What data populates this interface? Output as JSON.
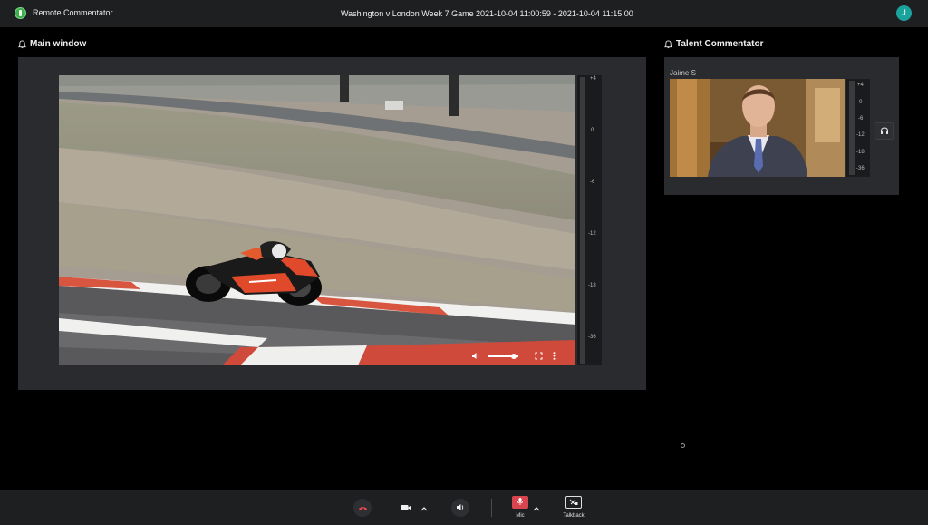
{
  "app": {
    "name": "Remote Commentator",
    "user_initial": "J"
  },
  "session": {
    "event_title": "Washington v London Week 7 Game",
    "time_range": "2021-10-04 11:00:59 - 2021-10-04 11:15:00"
  },
  "main_window": {
    "title": "Main window",
    "audio_meter_ticks": [
      "+4",
      "0",
      "-6",
      "-12",
      "-18",
      "-36"
    ],
    "player": {
      "volume_level": 0.85
    }
  },
  "talent": {
    "title": "Talent Commentator",
    "name": "Jaime S",
    "audio_meter_ticks": [
      "+4",
      "0",
      "-6",
      "-12",
      "-18",
      "-36"
    ]
  },
  "toolbar": {
    "mic_label": "Mic",
    "talkback_label": "Talkback"
  },
  "colors": {
    "background": "#000000",
    "bar": "#1e1f21",
    "panel": "#2a2b2e",
    "avatar": "#1aa39c",
    "hangup": "#e0474c",
    "mic_muted": "#d9454f",
    "logo": "#3fae4d"
  },
  "icons": {
    "logo": "app-logo-icon",
    "bell": "bell-icon",
    "volume": "volume-icon",
    "fullscreen": "fullscreen-icon",
    "more": "more-vertical-icon",
    "headset": "headset-icon",
    "hangup": "phone-hangup-icon",
    "camera": "camera-icon",
    "speaker": "speaker-icon",
    "mic": "mic-muted-icon",
    "talkback": "talkback-icon",
    "chevron": "chevron-up-icon"
  }
}
